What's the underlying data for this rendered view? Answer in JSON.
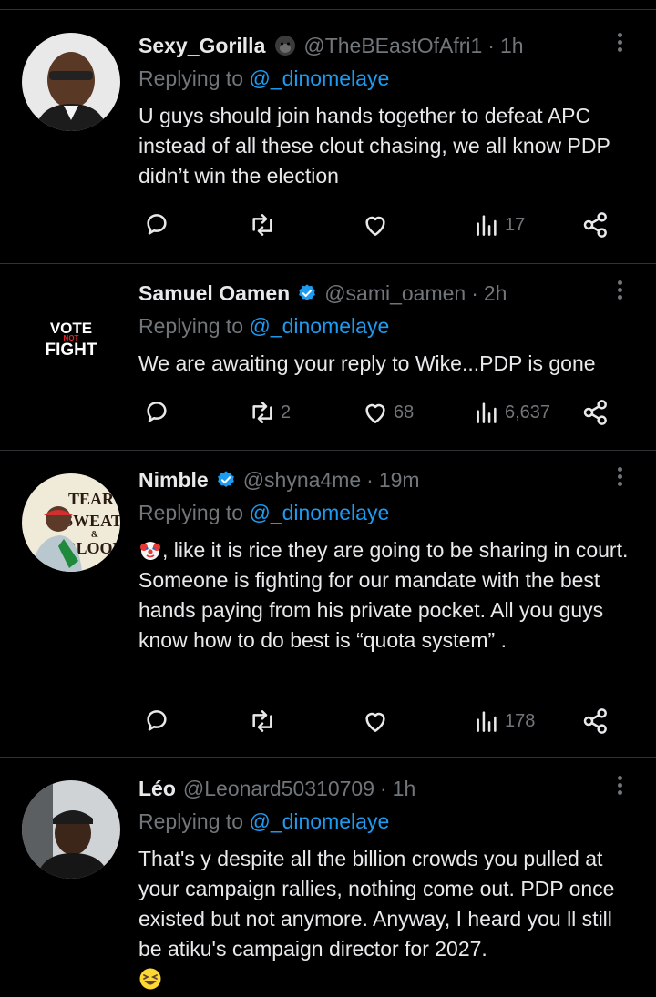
{
  "colors": {
    "background": "#000000",
    "text": "#e7e9ea",
    "muted": "#71767b",
    "link": "#1d9bf0",
    "verified": "#1d9bf0",
    "divider": "#2f3336"
  },
  "tweets": [
    {
      "name": "Sexy_Gorilla",
      "handle": "@TheBEastOfAfri1",
      "dot": "·",
      "time": "1h",
      "replying_prefix": "Replying to ",
      "replying_to": "@_dinomelaye",
      "text": "U guys should join hands together to defeat APC instead of all these clout chasing, we all know PDP didn’t win the election",
      "replies": "",
      "retweets": "",
      "likes": "",
      "views": "17",
      "name_icon": "gorilla-emoji-icon"
    },
    {
      "name": "Samuel Oamen",
      "handle": "@sami_oamen",
      "dot": "·",
      "time": "2h",
      "replying_prefix": "Replying to ",
      "replying_to": "@_dinomelaye",
      "text": "We are awaiting your reply to Wike...PDP is gone",
      "replies": "",
      "retweets": "2",
      "likes": "68",
      "views": "6,637",
      "avatar_text": {
        "line1": "VOTE",
        "line2": "NOT",
        "line3": "FIGHT"
      },
      "name_icon": "verified-badge-icon"
    },
    {
      "name": "Nimble",
      "handle": "@shyna4me",
      "dot": "·",
      "time": "19m",
      "replying_prefix": "Replying to ",
      "replying_to": "@_dinomelaye",
      "text": ", like it is rice they are going to be sharing in court. Someone is fighting for our mandate with the best hands paying from his private pocket. All you guys know how to do best is “quota system” .",
      "replies": "",
      "retweets": "",
      "likes": "",
      "views": "178",
      "avatar_text": {
        "line1": "TEAR",
        "line2": "SWEAT",
        "line3": "&",
        "line4": "BLOOD"
      },
      "name_icon": "verified-badge-icon",
      "text_icon": "clown-emoji-icon"
    },
    {
      "name": "Léo",
      "handle": "@Leonard50310709",
      "dot": "·",
      "time": "1h",
      "replying_prefix": "Replying to ",
      "replying_to": "@_dinomelaye",
      "text": "That's y  despite all the billion crowds you pulled at your campaign rallies, nothing come out. PDP once existed but not anymore. Anyway, I heard you ll still be atiku's campaign director for 2027.",
      "text_icon": "laughing-emoji-icon"
    }
  ],
  "icons": {
    "reply": "reply-icon",
    "retweet": "retweet-icon",
    "like": "heart-icon",
    "views": "views-chart-icon",
    "share": "share-icon",
    "more": "more-options-icon"
  }
}
